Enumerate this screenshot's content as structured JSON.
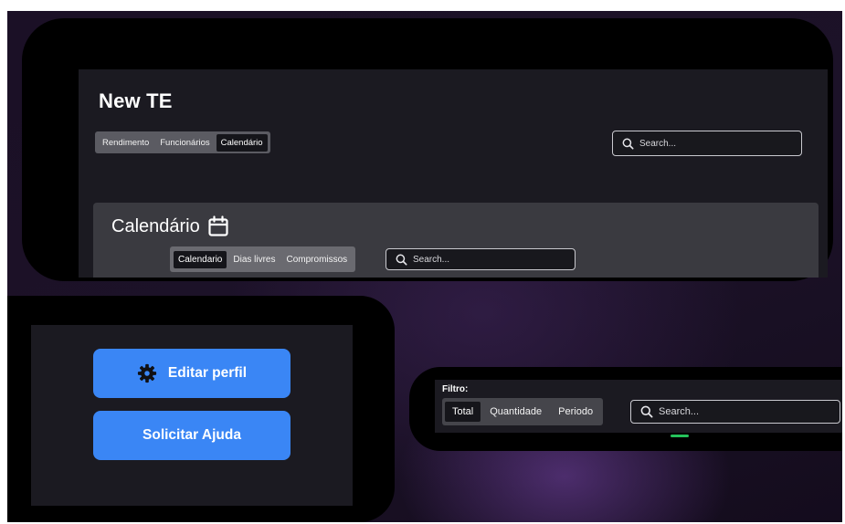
{
  "header": {
    "title": "New TE",
    "tabs": [
      {
        "label": "Rendimento"
      },
      {
        "label": "Funcionários"
      },
      {
        "label": "Calendário"
      }
    ],
    "search_placeholder": "Search..."
  },
  "calendar": {
    "title": "Calendário",
    "icon": "calendar-icon",
    "tabs": [
      {
        "label": "Calendario"
      },
      {
        "label": "Dias livres"
      },
      {
        "label": "Compromissos"
      }
    ],
    "search_placeholder": "Search..."
  },
  "profile": {
    "edit_label": "Editar perfil",
    "edit_icon": "gear-icon",
    "help_label": "Solicitar Ajuda",
    "button_color": "#3a86f5"
  },
  "filter": {
    "label": "Filtro:",
    "tabs": [
      {
        "label": "Total"
      },
      {
        "label": "Quantidade"
      },
      {
        "label": "Periodo"
      }
    ],
    "search_placeholder": "Search..."
  },
  "colors": {
    "panel": "#1b1a21",
    "accent_blue": "#3a86f5",
    "accent_green": "#25c35b"
  }
}
